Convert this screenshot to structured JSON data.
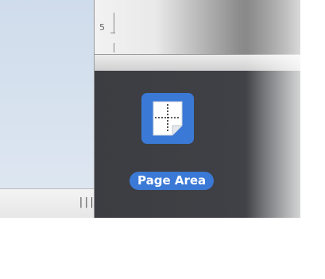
{
  "ruler": {
    "number": "5"
  },
  "sidebar": {
    "resize_handle_glyph": "|||"
  },
  "content": {
    "item": {
      "label": "Page Area",
      "icon": "page-area-icon",
      "selected": true
    }
  },
  "colors": {
    "selection_blue": "#3b79d6",
    "panel_background": "#3f4146",
    "sidebar_background": "#d8e2ee"
  }
}
